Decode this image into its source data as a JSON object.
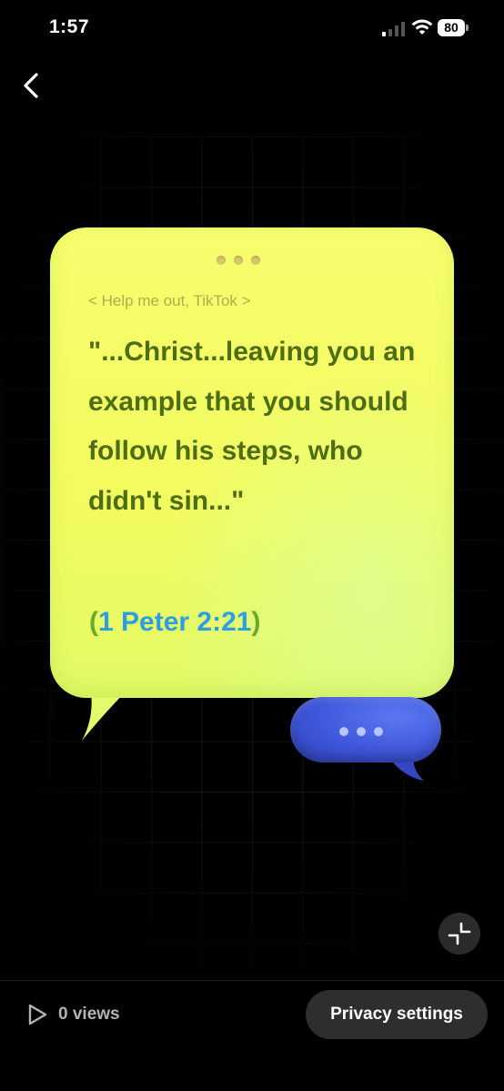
{
  "status_bar": {
    "time": "1:57",
    "battery": "80",
    "icons": [
      "signal-icon",
      "wifi-icon",
      "battery-icon"
    ]
  },
  "nav": {
    "back_icon": "chevron-left-icon"
  },
  "post": {
    "subtitle": "< Help me out, TikTok >",
    "quote": "\"...Christ...leaving you an example that you should follow his steps, who didn't sin...\"",
    "reference_open": "(",
    "reference_link": "1 Peter 2:21",
    "reference_close": ")",
    "colors": {
      "bubble": "#f3fb5f",
      "quote_text": "#4d6e15",
      "reference_link": "#2c9fe3",
      "typing_bubble": "#3e56db"
    }
  },
  "controls": {
    "collapse_icon": "minimize-icon"
  },
  "footer": {
    "views_icon": "play-icon",
    "views_label": "0 views",
    "privacy_button": "Privacy settings"
  }
}
